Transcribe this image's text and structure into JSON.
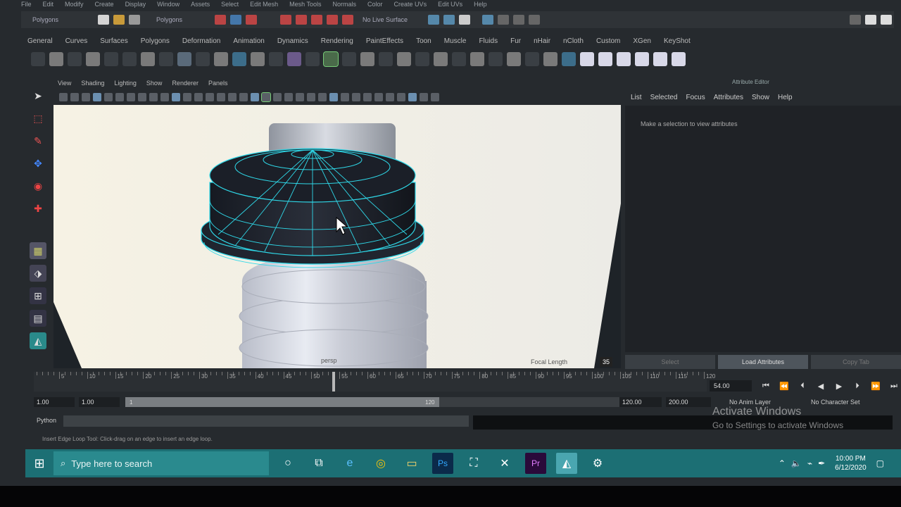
{
  "menu": [
    "File",
    "Edit",
    "Modify",
    "Create",
    "Display",
    "Window",
    "Assets",
    "Select",
    "Edit Mesh",
    "Mesh Tools",
    "Normals",
    "Color",
    "Create UVs",
    "Edit UVs",
    "Help"
  ],
  "status_line": {
    "mode": "Polygons",
    "menu_set": "Polygons",
    "live_surface": "No Live Surface"
  },
  "shelf_tabs": [
    "General",
    "Curves",
    "Surfaces",
    "Polygons",
    "Deformation",
    "Animation",
    "Dynamics",
    "Rendering",
    "PaintEffects",
    "Toon",
    "Muscle",
    "Fluids",
    "Fur",
    "nHair",
    "nCloth",
    "Custom",
    "XGen",
    "KeyShot"
  ],
  "viewport": {
    "menu": [
      "View",
      "Shading",
      "Lighting",
      "Show",
      "Renderer",
      "Panels"
    ],
    "camera_label": "persp",
    "hud_label": "Focal Length",
    "hud_value": "35"
  },
  "attribute_editor": {
    "title": "Attribute Editor",
    "menu": [
      "List",
      "Selected",
      "Focus",
      "Attributes",
      "Show",
      "Help"
    ],
    "message": "Make a selection to view attributes",
    "buttons": [
      "Select",
      "Load Attributes",
      "Copy Tab"
    ]
  },
  "timeline": {
    "ticks": [
      5,
      10,
      15,
      20,
      25,
      30,
      35,
      40,
      45,
      50,
      55,
      60,
      65,
      70,
      75,
      80,
      85,
      90,
      95,
      100,
      105,
      110,
      115,
      120
    ],
    "start": 1,
    "end": 120,
    "current": 54,
    "current_label": "54.00"
  },
  "range": {
    "start_field": "1.00",
    "anim_start": "1.00",
    "slider_start": "1",
    "slider_end": "120",
    "end_field": "120.00",
    "anim_end": "200.00",
    "anim_layer": "No Anim Layer",
    "char_set": "No Character Set"
  },
  "command_line": {
    "label": "Python"
  },
  "help_line": "Insert Edge Loop Tool: Click-drag on an edge to insert an edge loop.",
  "watermark": {
    "line1": "Activate Windows",
    "line2": "Go to Settings to activate Windows"
  },
  "taskbar": {
    "search_placeholder": "Type here to search",
    "time": "10:00 PM",
    "date": "6/12/2020"
  },
  "colors": {
    "wireframe": "#2fd8e8",
    "taskbar": "#1c6f74",
    "maya_bg": "#262a2e"
  }
}
